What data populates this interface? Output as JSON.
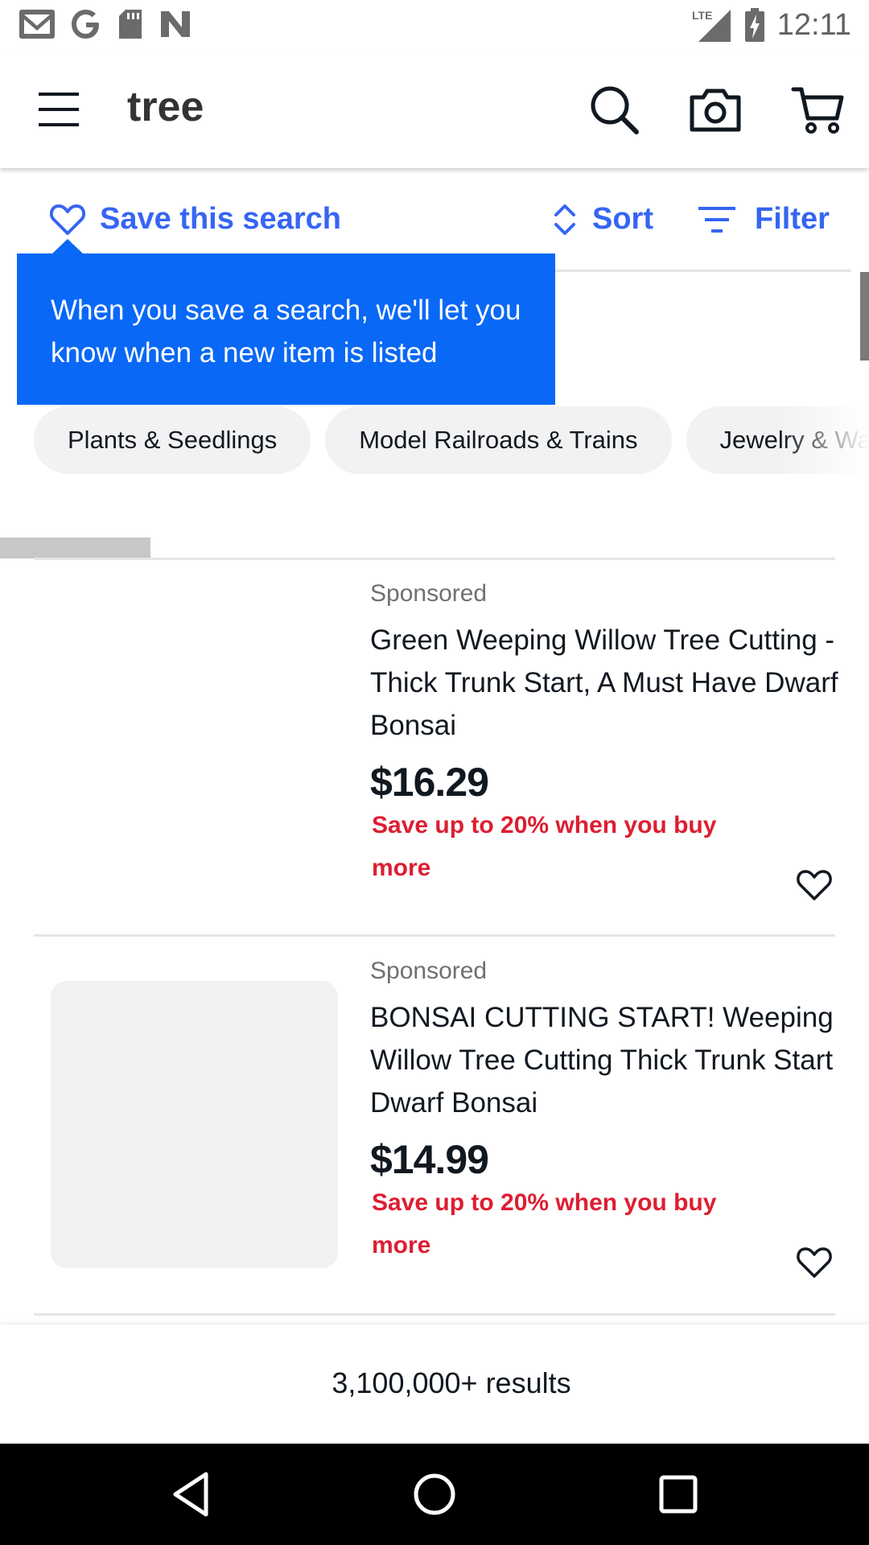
{
  "status_bar": {
    "time": "12:11",
    "network": "LTE",
    "notification_icons": [
      "gmail-icon",
      "google-icon",
      "sd-card-icon",
      "n-app-icon"
    ]
  },
  "app_bar": {
    "query": "tree",
    "icons": [
      "menu-icon",
      "search-icon",
      "camera-icon",
      "cart-icon"
    ]
  },
  "toolbar": {
    "save_search": "Save this search",
    "sort": "Sort",
    "filter": "Filter",
    "accent_color": "#3665f3"
  },
  "tooltip": {
    "text": "When you save a search, we'll let you know when a new item is listed",
    "color": "#0968f6"
  },
  "categories": [
    "Plants & Seedlings",
    "Model Railroads & Trains",
    "Jewelry & Watches"
  ],
  "loading_progress": 0.18,
  "listings": [
    {
      "sponsored": "Sponsored",
      "title": "Green Weeping Willow Tree Cutting - Thick Trunk Start, A Must Have Dwarf Bonsai",
      "price": "$16.29",
      "promo": "Save up to 20% when you buy more"
    },
    {
      "sponsored": "Sponsored",
      "title": "BONSAI CUTTING START! Weeping Willow Tree Cutting Thick Trunk Start Dwarf Bonsai",
      "price": "$14.99",
      "promo": "Save up to 20% when you buy more"
    }
  ],
  "promo_color": "#dd1e31",
  "results": {
    "text": "3,100,000+ results"
  }
}
